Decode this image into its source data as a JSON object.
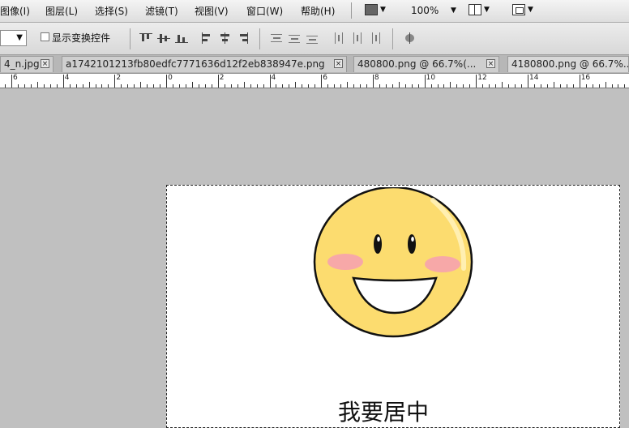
{
  "menu": {
    "items": [
      "图像(I)",
      "图层(L)",
      "选择(S)",
      "滤镜(T)",
      "视图(V)",
      "窗口(W)",
      "帮助(H)"
    ],
    "zoom": "100%"
  },
  "options": {
    "show_transform_label": "显示变换控件"
  },
  "tabs": [
    {
      "label": "4_n.jpg"
    },
    {
      "label": "a1742101213fb80edfc7771636d12f2eb838947e.png"
    },
    {
      "label": "480800.png @ 66.7%(..."
    },
    {
      "label": "4180800.png @ 66.7%..."
    }
  ],
  "ruler": {
    "labels": [
      "6",
      "4",
      "2",
      "0",
      "2",
      "4",
      "6",
      "8",
      "10",
      "12",
      "14",
      "16"
    ]
  },
  "canvas": {
    "text": "我要居中",
    "smiley": {
      "face_color": "#FCDC6F",
      "cheek_color": "#F7A8A8"
    }
  },
  "close_glyph": "×"
}
